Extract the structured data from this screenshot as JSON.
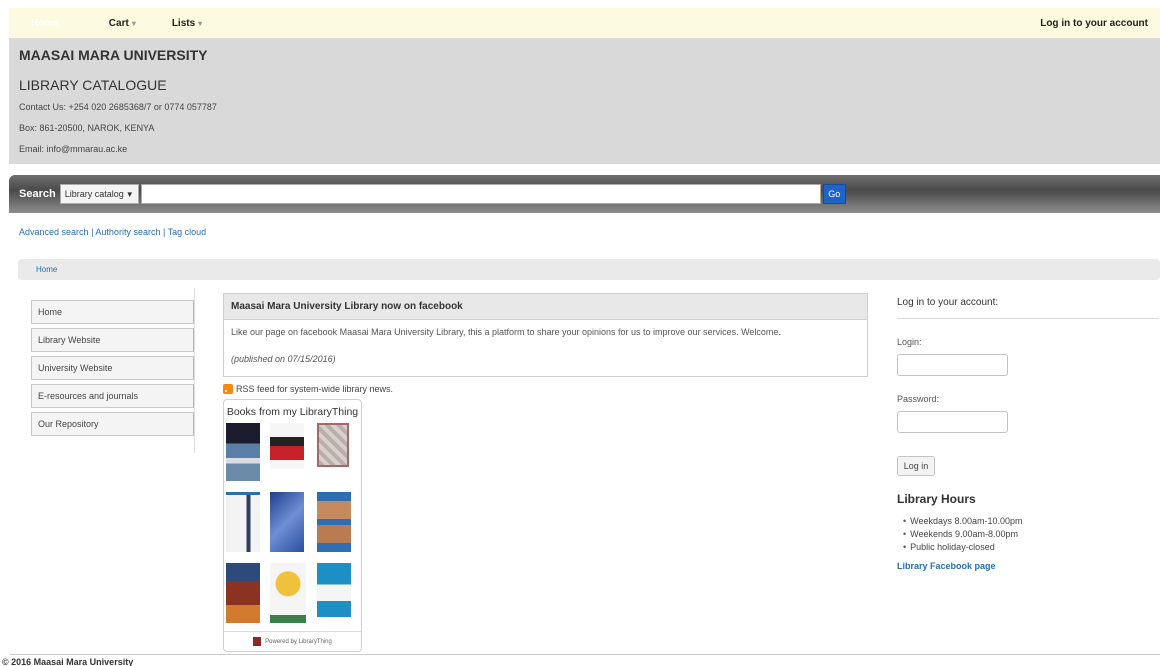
{
  "topbar": {
    "home": "Home",
    "cart": "Cart",
    "lists": "Lists",
    "login": "Log in to your account"
  },
  "header": {
    "university": "MAASAI MARA UNIVERSITY",
    "catalogue": "LIBRARY CATALOGUE",
    "contact_phone": "Contact Us: +254 020 2685368/7 or 0774 057787",
    "box": "Box: 861-20500, NAROK, KENYA",
    "email": "Email: info@mmarau.ac.ke"
  },
  "search": {
    "label": "Search",
    "scope": "Library catalog",
    "query": "",
    "go": "Go"
  },
  "links": {
    "advanced": "Advanced search",
    "authority": "Authority search",
    "tagcloud": "Tag cloud",
    "sep": "|"
  },
  "breadcrumb": {
    "home": "Home"
  },
  "nav": [
    "Home",
    "Library Website",
    "University Website",
    "E-resources and journals",
    "Our Repository"
  ],
  "news": {
    "title": "Maasai Mara University Library now on facebook",
    "body": "Like our page on facebook Maasai Mara University Library, this a platform to share your opinions for us to improve our services. Welcome.",
    "date": "(published on 07/15/2016)"
  },
  "rss": "RSS feed for system-wide library news.",
  "librarything": {
    "title": "Books from my LibraryThing",
    "footer": "Powered by LibraryThing"
  },
  "login": {
    "title": "Log in to your account:",
    "login_label": "Login:",
    "login_value": "",
    "password_label": "Password:",
    "password_value": "",
    "button": "Log in"
  },
  "hours": {
    "title": "Library Hours",
    "items": [
      "Weekdays 8.00am-10.00pm",
      "Weekends 9.00am-8.00pm",
      "Public holiday-closed"
    ],
    "facebook": "Library Facebook page"
  },
  "footer": "© 2016 Maasai Mara University"
}
